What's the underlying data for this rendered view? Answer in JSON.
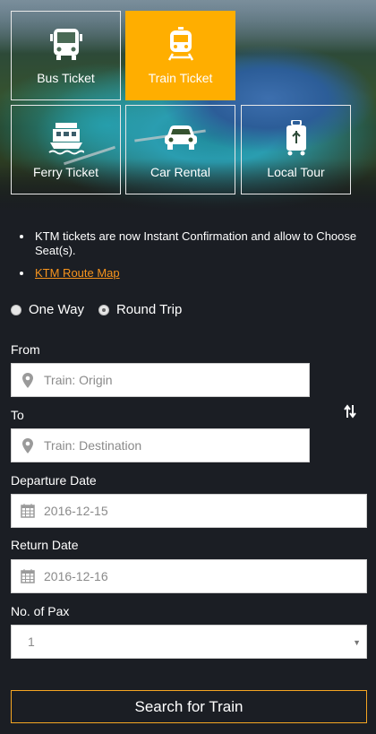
{
  "tiles": [
    {
      "label": "Bus Ticket",
      "icon": "bus-icon",
      "active": false
    },
    {
      "label": "Train Ticket",
      "icon": "train-icon",
      "active": true
    },
    {
      "label": "Ferry Ticket",
      "icon": "ferry-icon",
      "active": false
    },
    {
      "label": "Car Rental",
      "icon": "car-icon",
      "active": false
    },
    {
      "label": "Local Tour",
      "icon": "luggage-icon",
      "active": false
    }
  ],
  "notices": {
    "instant_confirmation": "KTM tickets are now Instant Confirmation and allow to Choose Seat(s).",
    "route_map_link": "KTM Route Map"
  },
  "trip_type": {
    "one_way": "One Way",
    "round_trip": "Round Trip",
    "selected": "round_trip"
  },
  "form": {
    "from_label": "From",
    "from_placeholder": "Train: Origin",
    "to_label": "To",
    "to_placeholder": "Train: Destination",
    "departure_label": "Departure Date",
    "departure_value": "2016-12-15",
    "return_label": "Return Date",
    "return_value": "2016-12-16",
    "pax_label": "No. of Pax",
    "pax_value": "1"
  },
  "search_button": "Search for Train",
  "colors": {
    "background": "#1b1e24",
    "accent": "#ffae00",
    "link": "#f7941d",
    "button_border": "#f5a623"
  }
}
